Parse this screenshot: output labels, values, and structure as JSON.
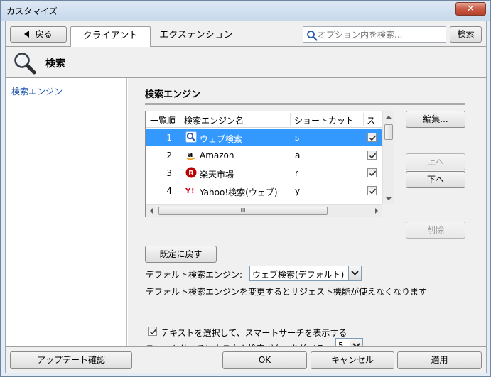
{
  "window": {
    "title": "カスタマイズ",
    "close_glyph": "✕"
  },
  "toolbar": {
    "back_label": "戻る",
    "tabs": [
      {
        "label": "クライアント",
        "active": true
      },
      {
        "label": "エクステンション",
        "active": false
      }
    ],
    "search": {
      "placeholder": "オプション内を検索...",
      "value": ""
    },
    "search_button": "検索"
  },
  "section": {
    "title": "検索"
  },
  "sidebar": {
    "items": [
      {
        "label": "検索エンジン",
        "selected": true
      }
    ]
  },
  "engines": {
    "group_title": "検索エンジン",
    "columns": {
      "order": "一覧順",
      "name": "検索エンジン名",
      "shortcut": "ショートカット",
      "smart": "スマ"
    },
    "rows": [
      {
        "order": "1",
        "name": "ウェブ検索",
        "shortcut": "s",
        "checked": true,
        "selected": true,
        "icon": "search-icon"
      },
      {
        "order": "2",
        "name": "Amazon",
        "shortcut": "a",
        "checked": true,
        "selected": false,
        "icon": "amazon-icon"
      },
      {
        "order": "3",
        "name": "楽天市場",
        "shortcut": "r",
        "checked": true,
        "selected": false,
        "icon": "rakuten-icon"
      },
      {
        "order": "4",
        "name": "Yahoo!検索(ウェブ)",
        "shortcut": "y",
        "checked": true,
        "selected": false,
        "icon": "yahoo-icon"
      }
    ],
    "buttons": {
      "edit": "編集...",
      "up": "上へ",
      "down": "下へ",
      "delete": "削除"
    },
    "scroll_thumb_glyph": "III"
  },
  "defaults": {
    "reset_label": "既定に戻す",
    "default_engine_label": "デフォルト検索エンジン:",
    "default_engine_value": "ウェブ検索(デフォルト)",
    "note": "デフォルト検索エンジンを変更するとサジェスト機能が使えなくなります"
  },
  "smart_search": {
    "show_label": "テキストを選択して、スマートサーチを表示する",
    "show_checked": true,
    "count_label": "スマートサーチにカスタム検索ボタンを並べる:",
    "count_value": "5"
  },
  "footer": {
    "update": "アップデート確認",
    "ok": "OK",
    "cancel": "キャンセル",
    "apply": "適用"
  },
  "colors": {
    "selection": "#3399ff",
    "sidebar_link": "#1e56b0",
    "window_border": "#6f86a3"
  }
}
